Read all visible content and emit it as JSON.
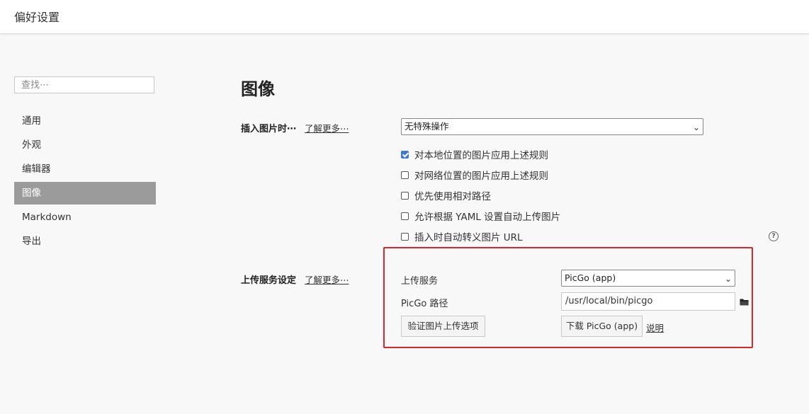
{
  "window": {
    "title": "偏好设置"
  },
  "search": {
    "placeholder": "查找⋯"
  },
  "sidebar": {
    "items": [
      {
        "label": "通用",
        "active": false
      },
      {
        "label": "外观",
        "active": false
      },
      {
        "label": "编辑器",
        "active": false
      },
      {
        "label": "图像",
        "active": true
      },
      {
        "label": "Markdown",
        "active": false
      },
      {
        "label": "导出",
        "active": false
      }
    ]
  },
  "main": {
    "heading": "图像",
    "insert_image": {
      "label": "插入图片时⋯",
      "learn_more": "了解更多⋯",
      "select_value": "无特殊操作"
    },
    "options": [
      {
        "label": "对本地位置的图片应用上述规则",
        "checked": true
      },
      {
        "label": "对网络位置的图片应用上述规则",
        "checked": false
      },
      {
        "label": "优先使用相对路径",
        "checked": false
      },
      {
        "label": "允许根据 YAML 设置自动上传图片",
        "checked": false
      },
      {
        "label": "插入时自动转义图片 URL",
        "checked": false
      }
    ],
    "help_icon": "help-circle-icon",
    "upload": {
      "label": "上传服务设定",
      "learn_more": "了解更多⋯",
      "service_label": "上传服务",
      "service_value": "PicGo (app)",
      "path_label": "PicGo 路径",
      "path_value": "/usr/local/bin/picgo",
      "folder_icon": "folder-icon",
      "verify_button": "验证图片上传选项",
      "download_button": "下载 PicGo (app)",
      "explain_link": "说明"
    }
  },
  "colors": {
    "accent": "#3c78d8",
    "highlight_border": "#d9262c",
    "active_nav": "#9b9b9b"
  }
}
